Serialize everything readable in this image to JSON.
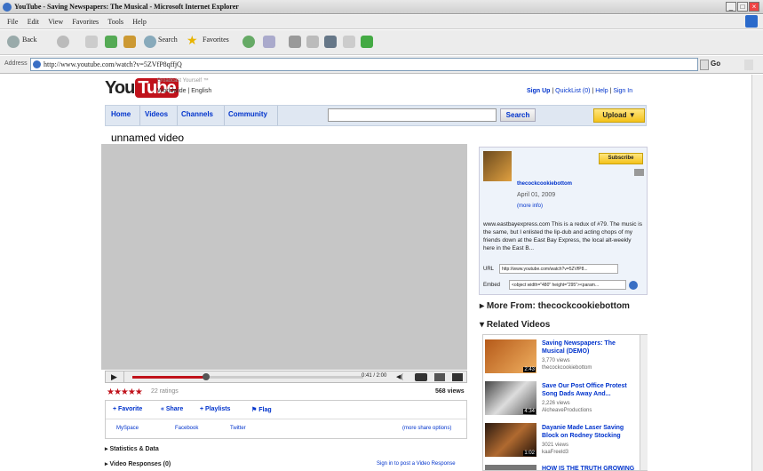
{
  "window": {
    "title": "YouTube - Saving Newspapers: The Musical - Microsoft Internet Explorer",
    "controls": [
      "_",
      "□",
      "×"
    ]
  },
  "menu": [
    "File",
    "Edit",
    "View",
    "Favorites",
    "Tools",
    "Help"
  ],
  "toolbar": {
    "back_label": "Back",
    "search_label": "Search",
    "favorites_label": "Favorites"
  },
  "address": {
    "label": "Address",
    "url": "http://www.youtube.com/watch?v=5ZVfP8qffjQ",
    "go_label": "Go"
  },
  "site": {
    "logo_you": "You",
    "logo_tube": "Tube",
    "tagline": "Broadcast Yourself ™",
    "locale": "Worldwide | English",
    "top_links": [
      "Sign Up",
      "QuickList (0)",
      "Help",
      "Sign In"
    ],
    "nav_tabs": [
      "Home",
      "Videos",
      "Channels",
      "Community"
    ],
    "search_button": "Search",
    "upload_button": "Upload"
  },
  "video": {
    "title": "unnamed video",
    "time": "0:41 / 2:00",
    "progress": 0.32,
    "ratings": "22 ratings",
    "views": "568 views",
    "actions": [
      "Favorite",
      "Share",
      "Playlists",
      "Flag"
    ],
    "share_links": [
      "MySpace",
      "Facebook",
      "Twitter"
    ],
    "more_share": "(more share options)",
    "sections": [
      "Statistics & Data",
      "Video Responses (0)"
    ],
    "response_link": "Sign in to post a Video Response"
  },
  "channel": {
    "subscribe": "Subscribe",
    "username": "thecockcookiebottom",
    "date": "April 01, 2009",
    "more_info": "(more info)",
    "description": "www.eastbayexpress.com This is a redux of #79. The music is the same, but I enlisted the lip-dub and acting chops of my friends down at the East Bay Express, the local alt-weekly here in the East B...",
    "url_label": "URL",
    "url_value": "http://www.youtube.com/watch?v=5ZVfP8...",
    "embed_label": "Embed",
    "embed_value": "<object width=\"480\" height=\"295\"><param..."
  },
  "more_from": "More From: thecockcookiebottom",
  "related_heading": "Related Videos",
  "related": [
    {
      "title": "Saving Newspapers: The Musical (DEMO)",
      "views": "3,770 views",
      "user": "thecockcookiebottom",
      "duration": "2:43"
    },
    {
      "title": "Save Our Post Office Protest Song Dads Away And...",
      "views": "2,226 views",
      "user": "AlcheaveProductions",
      "duration": "4:34"
    },
    {
      "title": "Dayanie Made Laser Saving Block on Rodney Stocking",
      "views": "3021 views",
      "user": "kaaFreeld3",
      "duration": "1:02"
    },
    {
      "title": "HOW IS THE TRUTH GROWING",
      "views": "",
      "user": "",
      "duration": ""
    }
  ],
  "colors": {
    "accent_red": "#c0121b",
    "link_blue": "#0033cc",
    "upload_yellow": "#f4c21b"
  }
}
